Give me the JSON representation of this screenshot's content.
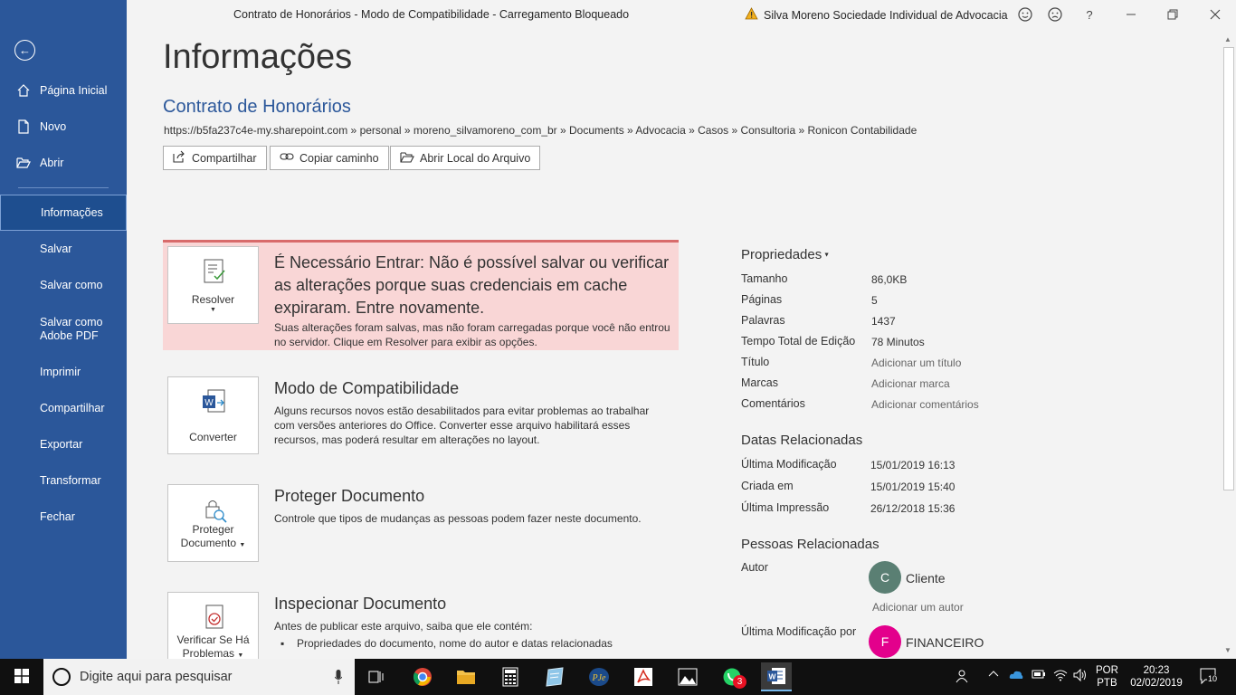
{
  "window": {
    "title": "Contrato de Honorários  -  Modo de Compatibilidade  -  Carregamento Bloqueado",
    "account": "Silva Moreno Sociedade Individual de Advocacia",
    "help": "?"
  },
  "sidebar": {
    "items": [
      {
        "label": "Página Inicial"
      },
      {
        "label": "Novo"
      },
      {
        "label": "Abrir"
      },
      {
        "label": "Informações"
      },
      {
        "label": "Salvar"
      },
      {
        "label": "Salvar como"
      },
      {
        "label": "Salvar como Adobe PDF"
      },
      {
        "label": "Imprimir"
      },
      {
        "label": "Compartilhar"
      },
      {
        "label": "Exportar"
      },
      {
        "label": "Transformar"
      },
      {
        "label": "Fechar"
      }
    ]
  },
  "main": {
    "page_title": "Informações",
    "doc_title": "Contrato de Honorários",
    "doc_path": "https://b5fa237c4e-my.sharepoint.com » personal » moreno_silvamoreno_com_br » Documents » Advocacia » Casos » Consultoria » Ronicon Contabilidade",
    "path_buttons": {
      "share": "Compartilhar",
      "copy": "Copiar caminho",
      "open": "Abrir Local do Arquivo"
    },
    "warning": {
      "button": "Resolver",
      "heading": "É Necessário Entrar: Não é possível salvar ou verificar as alterações porque suas credenciais em cache expiraram. Entre novamente.",
      "text": "Suas alterações foram salvas, mas não foram carregadas porque você não entrou no servidor. Clique em Resolver para exibir as opções."
    },
    "compat": {
      "button": "Converter",
      "heading": "Modo de Compatibilidade",
      "text": "Alguns recursos novos estão desabilitados para evitar problemas ao trabalhar com versões anteriores do Office. Converter esse arquivo habilitará esses recursos, mas poderá resultar em alterações no layout."
    },
    "protect": {
      "button_line1": "Proteger",
      "button_line2": "Documento",
      "heading": "Proteger Documento",
      "text": "Controle que tipos de mudanças as pessoas podem fazer neste documento."
    },
    "inspect": {
      "button_line1": "Verificar Se Há",
      "button_line2": "Problemas",
      "heading": "Inspecionar Documento",
      "text": "Antes de publicar este arquivo, saiba que ele contém:",
      "bullet1": "Propriedades do documento, nome do autor e datas relacionadas"
    }
  },
  "properties": {
    "heading": "Propriedades",
    "rows": [
      {
        "label": "Tamanho",
        "value": "86,0KB"
      },
      {
        "label": "Páginas",
        "value": "5"
      },
      {
        "label": "Palavras",
        "value": "1437"
      },
      {
        "label": "Tempo Total de Edição",
        "value": "78 Minutos"
      },
      {
        "label": "Título",
        "value": "Adicionar um título"
      },
      {
        "label": "Marcas",
        "value": "Adicionar marca"
      },
      {
        "label": "Comentários",
        "value": "Adicionar comentários"
      }
    ],
    "dates_heading": "Datas Relacionadas",
    "dates": [
      {
        "label": "Última Modificação",
        "value": "15/01/2019 16:13"
      },
      {
        "label": "Criada em",
        "value": "15/01/2019 15:40"
      },
      {
        "label": "Última Impressão",
        "value": "26/12/2018 15:36"
      }
    ],
    "people_heading": "Pessoas Relacionadas",
    "author_label": "Autor",
    "author_initial": "C",
    "author_name": "Cliente",
    "add_author": "Adicionar um autor",
    "modified_by_label": "Última Modificação por",
    "modified_by_initial": "F",
    "modified_by_name": "FINANCEIRO"
  },
  "taskbar": {
    "search_placeholder": "Digite aqui para pesquisar",
    "whatsapp_badge": "3",
    "lang1": "POR",
    "lang2": "PTB",
    "time": "20:23",
    "date": "02/02/2019",
    "notif_count": "10"
  },
  "colors": {
    "sidebar": "#2b579a",
    "warning_bg": "#f9d6d6",
    "warning_border": "#d86b6b",
    "avatar_author": "#5a7f73",
    "avatar_modified": "#e3008c"
  }
}
